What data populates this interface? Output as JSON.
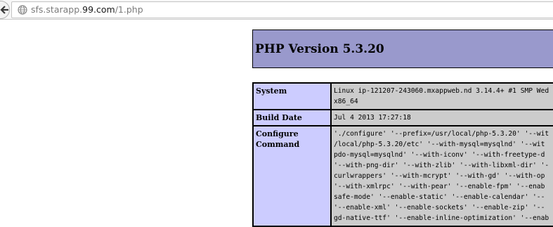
{
  "browser": {
    "url_prefix": "sfs.starapp.",
    "url_domain": "99.com",
    "url_path": "/1.php",
    "back_icon": "back-arrow-icon",
    "site_icon": "globe-icon"
  },
  "page": {
    "title": "PHP Version 5.3.20",
    "header_color": "#9999cc",
    "label_color": "#ccccff",
    "value_color": "#cccccc",
    "rows": [
      {
        "label": "System",
        "value": "Linux ip-121207-243060.mxappweb.nd 3.14.4+ #1 SMP Wed\nx86_64"
      },
      {
        "label": "Build Date",
        "value": "Jul 4 2013 17:27:18"
      },
      {
        "label": "Configure\nCommand",
        "value": "'./configure' '--prefix=/usr/local/php-5.3.20' '--wit\n/local/php-5.3.20/etc' '--with-mysql=mysqlnd' '--wit\npdo-mysql=mysqlnd' '--with-iconv' '--with-freetype-d\n'--with-png-dir' '--with-zlib' '--with-libxml-dir' '-\ncurlwrappers' '--with-mcrypt' '--with-gd' '--with-op\n'--with-xmlrpc' '--with-pear' '--enable-fpm' '--enab\nsafe-mode' '--enable-static' '--enable-calendar' '--\n'--enable-xml' '--enable-sockets' '--enable-zip' '--\ngd-native-ttf' '--enable-inline-optimization' '--enab"
      }
    ]
  }
}
